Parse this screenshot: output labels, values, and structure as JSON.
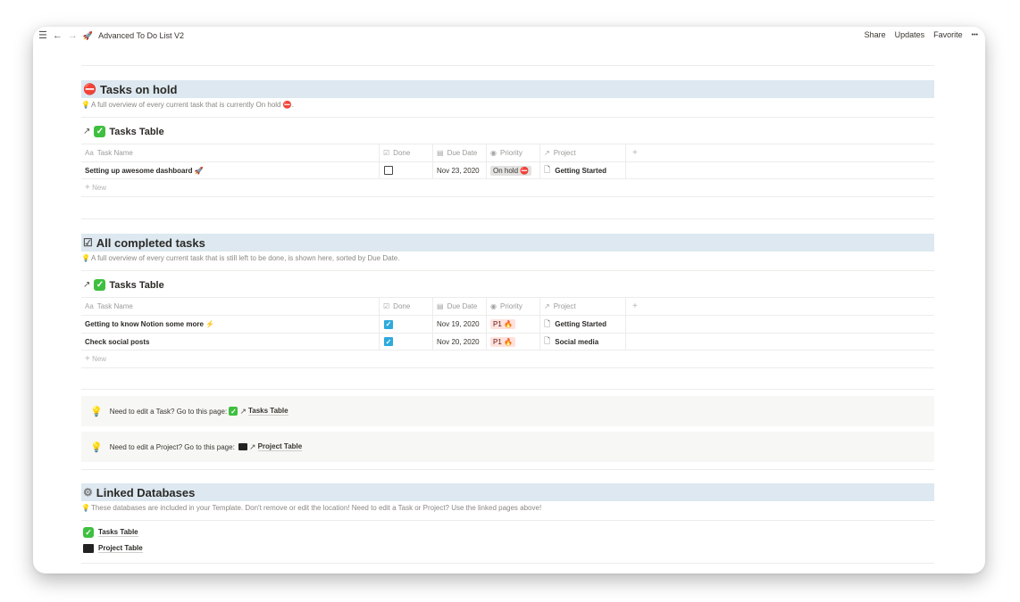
{
  "topbar": {
    "menu_icon": "hamburger-menu-icon",
    "back_icon": "arrow-left-icon",
    "forward_icon": "arrow-right-icon",
    "page_emoji": "🚀",
    "page_title": "Advanced To Do List V2",
    "share": "Share",
    "updates": "Updates",
    "favorite": "Favorite",
    "more": "•••"
  },
  "sections": {
    "on_hold": {
      "emoji": "⛔",
      "title": "Tasks on hold",
      "description": "A full overview of every current task that is currently On hold ⛔.",
      "table_title": "Tasks Table",
      "columns": [
        "Task Name",
        "Done",
        "Due Date",
        "Priority",
        "Project"
      ],
      "rows": [
        {
          "name": "Setting up awesome dashboard 🚀",
          "done": false,
          "due": "Nov 23, 2020",
          "priority": "On hold ⛔",
          "project": "Getting Started"
        }
      ],
      "new_label": "New"
    },
    "completed": {
      "emoji": "☑",
      "title": "All completed tasks",
      "description": "A full overview of every current task that is still left to be done, is shown here, sorted by Due Date.",
      "table_title": "Tasks Table",
      "columns": [
        "Task Name",
        "Done",
        "Due Date",
        "Priority",
        "Project"
      ],
      "rows": [
        {
          "name": "Getting to know Notion some more ⚡",
          "done": true,
          "due": "Nov 19, 2020",
          "priority": "P1 🔥",
          "project": "Getting Started"
        },
        {
          "name": "Check social posts",
          "done": true,
          "due": "Nov 20, 2020",
          "priority": "P1 🔥",
          "project": "Social media"
        }
      ],
      "new_label": "New"
    },
    "callouts": [
      {
        "text": "Need to edit a Task? Go to this page:",
        "link": "Tasks Table"
      },
      {
        "text": "Need to edit a Project? Go to this page:",
        "link": "Project Table"
      }
    ],
    "linked": {
      "emoji": "⚙",
      "title": "Linked Databases",
      "description": "These databases are included in your Template. Don't remove or edit the location! Need to edit a Task or Project? Use the linked pages above!",
      "items": [
        "Tasks Table",
        "Project Table"
      ]
    }
  },
  "colors": {
    "heading_bg": "#dde8f0",
    "checkbox_checked": "#2eaadc",
    "tag_red_bg": "#ffe2dd",
    "tag_gray_bg": "#e3e2e0",
    "callout_bg": "#f7f7f5"
  }
}
